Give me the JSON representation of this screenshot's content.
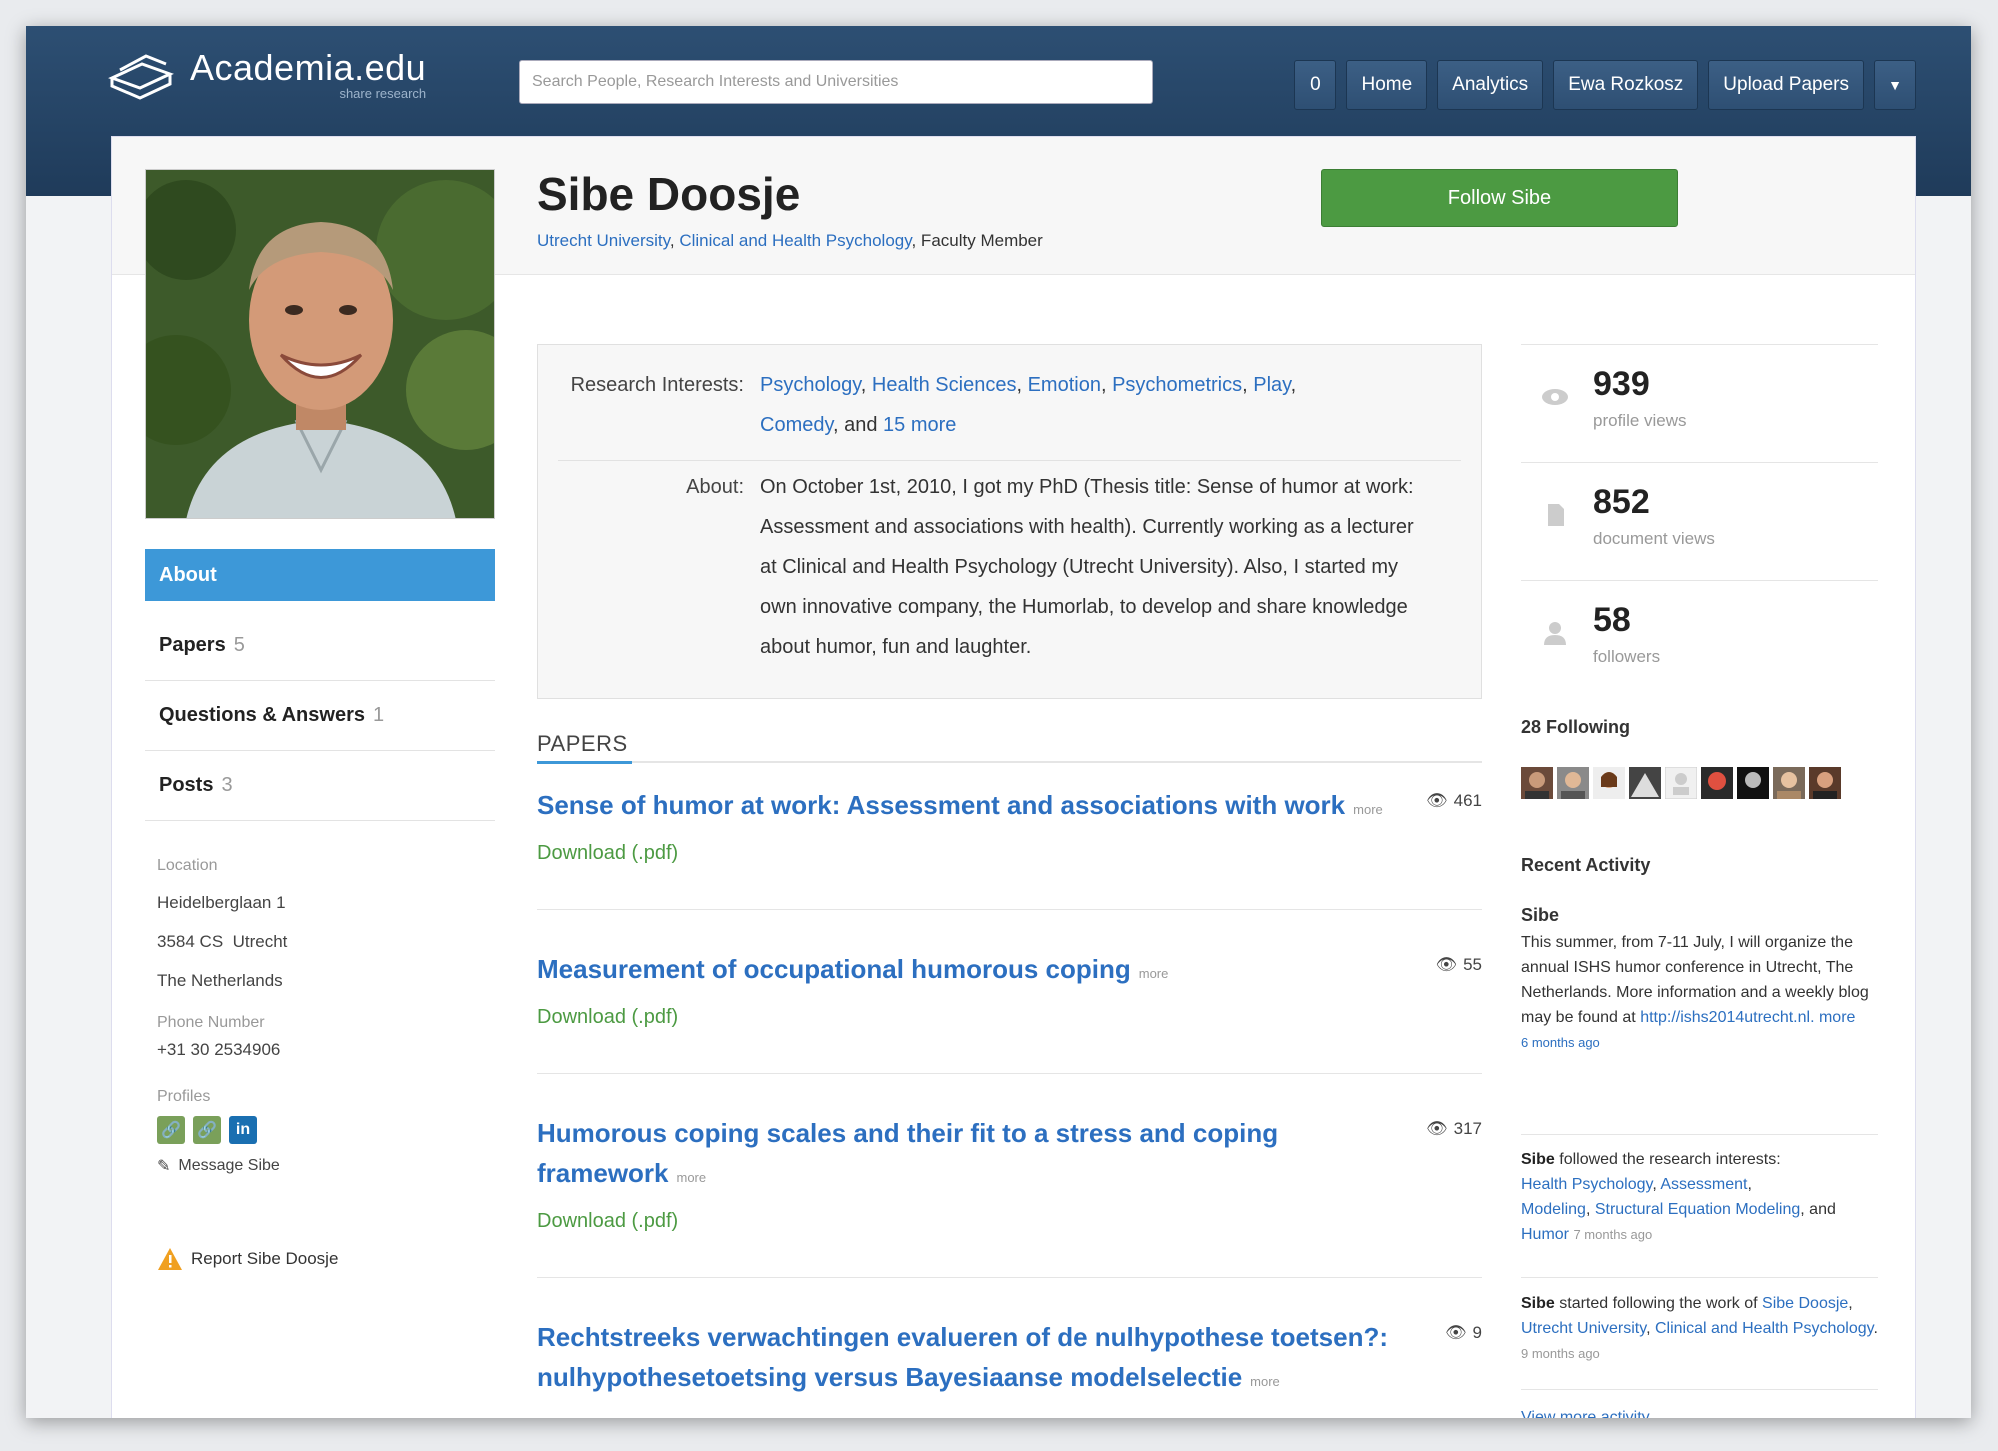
{
  "brand": {
    "name": "Academia.edu",
    "tagline": "share research"
  },
  "search": {
    "placeholder": "Search People, Research Interests and Universities"
  },
  "nav": {
    "count": "0",
    "home": "Home",
    "analytics": "Analytics",
    "user": "Ewa Rozkosz",
    "upload": "Upload Papers"
  },
  "profile": {
    "name": "Sibe Doosje",
    "university": "Utrecht University",
    "department": "Clinical and Health Psychology",
    "role_suffix": ", Faculty Member",
    "follow_label": "Follow Sibe"
  },
  "sidenav": {
    "about": "About",
    "papers": "Papers",
    "papers_count": "5",
    "qa": "Questions & Answers",
    "qa_count": "1",
    "posts": "Posts",
    "posts_count": "3"
  },
  "contact": {
    "location_label": "Location",
    "location_lines": [
      "Heidelberglaan 1",
      "3584 CS  Utrecht",
      "The Netherlands"
    ],
    "phone_label": "Phone Number",
    "phone": "+31 30 2534906",
    "profiles_label": "Profiles",
    "message": "Message Sibe",
    "report": "Report Sibe Doosje"
  },
  "interests": {
    "label": "Research Interests:",
    "items": [
      "Psychology",
      "Health Sciences",
      "Emotion",
      "Psychometrics",
      "Play",
      "Comedy"
    ],
    "and_text": ", and ",
    "more": "15 more"
  },
  "about": {
    "label": "About:",
    "text": "On October 1st, 2010, I got my PhD (Thesis title: Sense of humor at work: Assessment and associations with health). Currently working as a lecturer at Clinical and Health Psychology (Utrecht University). Also, I started my own innovative company, the Humorlab, to develop and share knowledge about humor, fun and laughter."
  },
  "papers": {
    "heading": "PAPERS",
    "more_label": "more",
    "download_label": "Download (.pdf)",
    "items": [
      {
        "title": "Sense of humor at work: Assessment and associations with work",
        "views": "461"
      },
      {
        "title": "Measurement of occupational humorous coping",
        "views": "55"
      },
      {
        "title": "Humorous coping scales and their fit to a stress and coping framework",
        "views": "317"
      },
      {
        "title": "Rechtstreeks verwachtingen evalueren of de nulhypothese toetsen?: nulhypothesetoetsing versus Bayesiaanse modelselectie",
        "views": "9"
      }
    ]
  },
  "stats": [
    {
      "value": "939",
      "label": "profile views",
      "icon": "eye-icon"
    },
    {
      "value": "852",
      "label": "document views",
      "icon": "document-icon"
    },
    {
      "value": "58",
      "label": "followers",
      "icon": "person-icon"
    }
  ],
  "following": {
    "label": "28 Following"
  },
  "recent": {
    "heading": "Recent Activity",
    "a1_name": "Sibe",
    "a1_text": "This summer, from 7-11 July, I will organize the annual ISHS humor conference in Utrecht, The Netherlands. More information and a weekly blog may be found at ",
    "a1_link": "http://ishs2014utrecht.nl.",
    "a1_more": "more",
    "a1_ago": "6 months ago",
    "a2_name": "Sibe",
    "a2_text": " followed the research interests: ",
    "a2_links": [
      "Health Psychology",
      "Assessment",
      "Modeling",
      "Structural Equation Modeling",
      "Humor"
    ],
    "a2_ago": "7 months ago",
    "a3_name": "Sibe",
    "a3_text": " started following the work of ",
    "a3_links": [
      "Sibe Doosje",
      "Utrecht University",
      "Clinical and Health Psychology"
    ],
    "a3_ago": "9 months ago",
    "view_more": "View more activity"
  },
  "colors": {
    "topbar": "#1f3b5a",
    "link": "#2c6fc0",
    "follow": "#4c9a42",
    "active_nav": "#3d98d8"
  }
}
